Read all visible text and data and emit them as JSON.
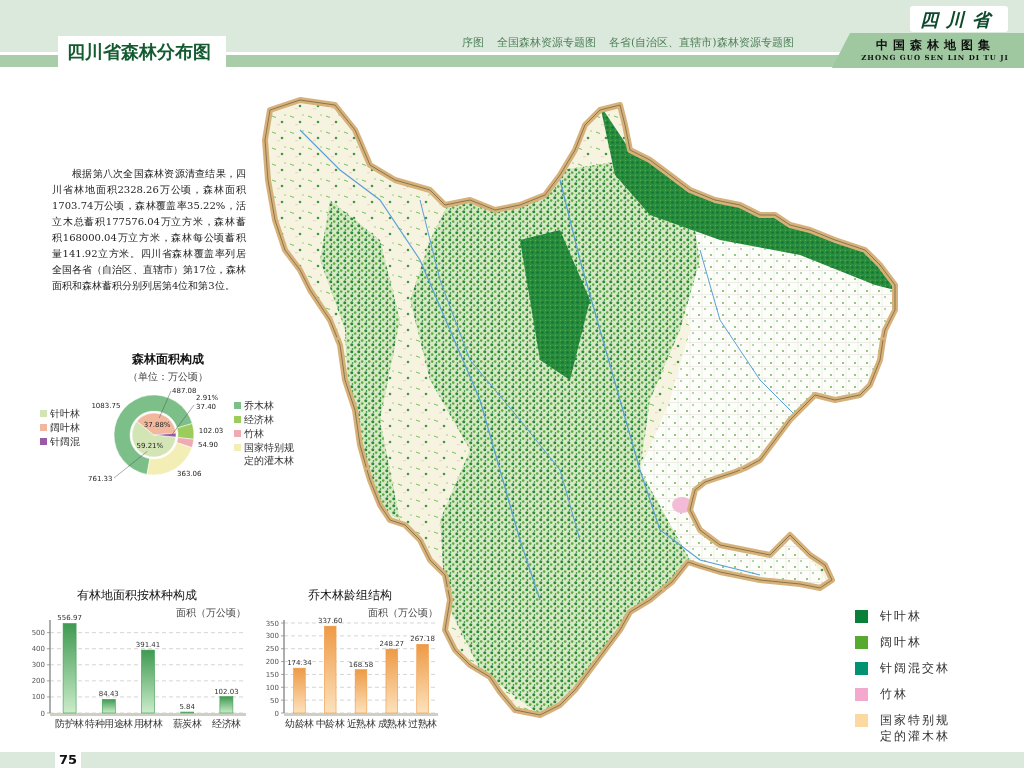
{
  "header": {
    "title": "四川省森林分布图",
    "nav": [
      "序图",
      "全国森林资源专题图",
      "各省(自治区、直辖市)森林资源专题图"
    ],
    "province": "四川省",
    "atlas_title": "中国森林地图集",
    "atlas_pinyin": "ZHONG GUO SEN LIN DI TU JI"
  },
  "intro": "根据第八次全国森林资源清查结果，四川省林地面积2328.26万公顷，森林面积1703.74万公顷，森林覆盖率35.22%，活立木总蓄积177576.04万立方米，森林蓄积168000.04万立方米，森林每公顷蓄积量141.92立方米。四川省森林覆盖率列居全国各省（自治区、直辖市）第17位，森林面积和森林蓄积分别列居第4位和第3位。",
  "forest_area_chart": {
    "title": "森林面积构成",
    "unit": "（单位：万公顷）",
    "inner_ring": {
      "chart_data": {
        "type": "pie",
        "categories": [
          "针叶林",
          "阔叶林",
          "针阔混"
        ],
        "colors": [
          "#d3e5b4",
          "#f2b89d",
          "#9b5aa7"
        ],
        "values": [
          761.33,
          487.08,
          37.4
        ],
        "value_labels": [
          "761.33",
          "487.08",
          "37.40"
        ],
        "annotations": [
          {
            "text": "59.21%"
          },
          {
            "text": "37.88%"
          },
          {
            "text": "2.91%"
          }
        ]
      }
    },
    "outer_ring": {
      "chart_data": {
        "type": "donut",
        "categories": [
          "乔木林",
          "经济林",
          "竹林",
          "国家特别规定的灌木林"
        ],
        "colors": [
          "#7dbf89",
          "#9ccc5c",
          "#efaab2",
          "#f3eeb6"
        ],
        "values": [
          1083.75,
          102.03,
          54.9,
          363.06
        ],
        "value_labels": [
          "1083.75",
          "102.03",
          "54.90",
          "363.06"
        ]
      }
    }
  },
  "bar_charts": [
    {
      "chart_data": {
        "type": "bar",
        "title": "有林地面积按林种构成",
        "ylabel": "面积（万公顷）",
        "categories": [
          "防护林",
          "特种用途林",
          "用材林",
          "薪炭林",
          "经济林"
        ],
        "values": [
          556.97,
          84.43,
          391.41,
          5.84,
          102.03
        ],
        "ylim": [
          0,
          560
        ],
        "yticks": [
          0,
          100,
          200,
          300,
          400,
          500
        ],
        "grid": true,
        "value_labels": [
          "556.97",
          "84.43",
          "391.41",
          "5.84",
          "102.03"
        ]
      }
    },
    {
      "chart_data": {
        "type": "bar",
        "title": "乔木林龄组结构",
        "ylabel": "面积（万公顷）",
        "categories": [
          "幼龄林",
          "中龄林",
          "近熟林",
          "成熟林",
          "过熟林"
        ],
        "values": [
          174.34,
          337.6,
          168.58,
          248.27,
          267.18
        ],
        "ylim": [
          0,
          350
        ],
        "yticks": [
          0,
          50,
          100,
          150,
          200,
          250,
          300,
          350
        ],
        "grid": true,
        "value_labels": [
          "174.34",
          "337.60",
          "168.58",
          "248.27",
          "267.18"
        ]
      }
    }
  ],
  "legend": [
    {
      "label": "针叶林",
      "color": "#0a7f37"
    },
    {
      "label": "阔叶林",
      "color": "#55aa2f"
    },
    {
      "label": "针阔混交林",
      "color": "#009271"
    },
    {
      "label": "竹林",
      "color": "#f3a9cd"
    },
    {
      "label": "国家特别规定的灌木林",
      "color": "#fdd9a2"
    }
  ],
  "page_number": "75"
}
